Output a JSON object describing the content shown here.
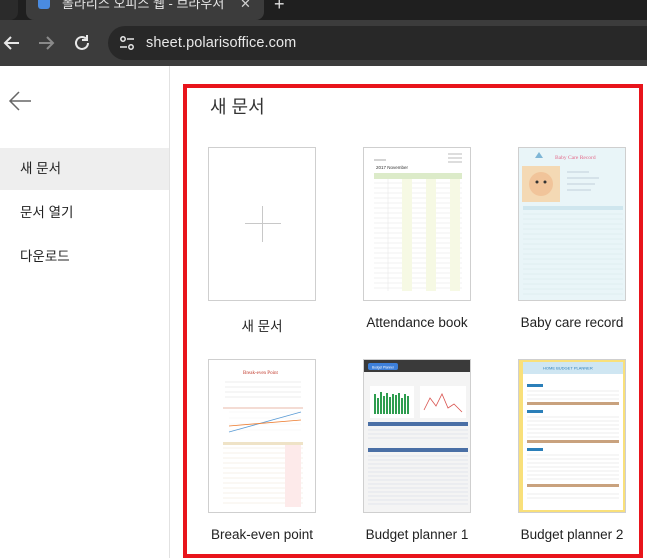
{
  "browser": {
    "tab_title": "폴라리스 오피스 웹 - 브라우저",
    "tab_close": "✕",
    "new_tab": "+",
    "url": "sheet.polarisoffice.com"
  },
  "sidebar": {
    "items": [
      {
        "label": "새 문서",
        "active": true
      },
      {
        "label": "문서 열기",
        "active": false
      },
      {
        "label": "다운로드",
        "active": false
      }
    ]
  },
  "main": {
    "title": "새 문서",
    "templates": [
      {
        "label": "새 문서"
      },
      {
        "label": "Attendance book",
        "thumb_title": "2017 November"
      },
      {
        "label": "Baby care record",
        "thumb_title": "Baby Care Record"
      },
      {
        "label": "Break-even point",
        "thumb_title": "Break-even Point"
      },
      {
        "label": "Budget planner 1",
        "thumb_title": "Budget Planner"
      },
      {
        "label": "Budget planner 2",
        "thumb_title": "HOME BUDGET PLANNER"
      }
    ]
  },
  "colors": {
    "highlight": "#e8141b",
    "chrome_dark": "#3c3c3c",
    "sidebar_active": "#eeeeee"
  }
}
